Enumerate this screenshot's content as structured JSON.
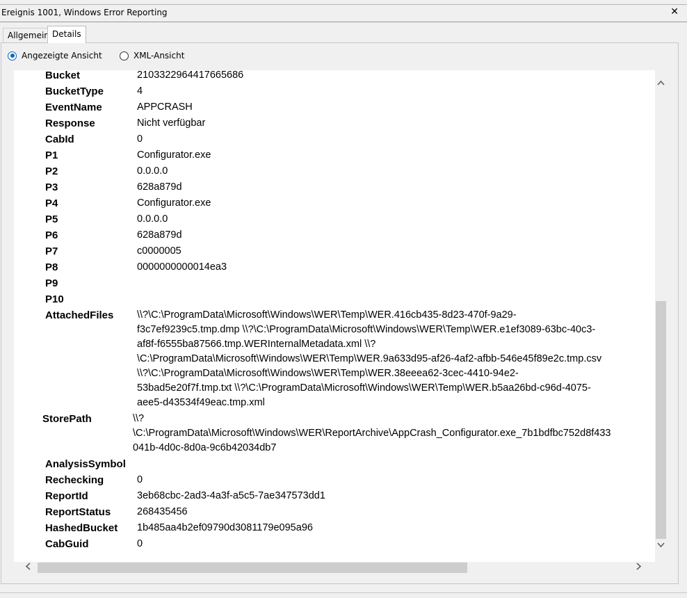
{
  "window": {
    "title": "Ereignis 1001, Windows Error Reporting",
    "close_glyph": "✕"
  },
  "tabs": [
    {
      "label": "Allgemein"
    },
    {
      "label": "Details"
    }
  ],
  "views": {
    "displayed": "Angezeigte Ansicht",
    "xml": "XML-Ansicht"
  },
  "fields": [
    {
      "key": "Bucket",
      "value": "2103322964417665686"
    },
    {
      "key": "BucketType",
      "value": "4"
    },
    {
      "key": "EventName",
      "value": "APPCRASH"
    },
    {
      "key": "Response",
      "value": "Nicht verfügbar"
    },
    {
      "key": "CabId",
      "value": "0"
    },
    {
      "key": "P1",
      "value": "Configurator.exe"
    },
    {
      "key": "P2",
      "value": "0.0.0.0"
    },
    {
      "key": "P3",
      "value": "628a879d"
    },
    {
      "key": "P4",
      "value": "Configurator.exe"
    },
    {
      "key": "P5",
      "value": "0.0.0.0"
    },
    {
      "key": "P6",
      "value": "628a879d"
    },
    {
      "key": "P7",
      "value": "c0000005"
    },
    {
      "key": "P8",
      "value": "0000000000014ea3"
    },
    {
      "key": "P9",
      "value": ""
    },
    {
      "key": "P10",
      "value": ""
    }
  ],
  "attached": {
    "key": "AttachedFiles",
    "lines": [
      "\\\\?\\C:\\ProgramData\\Microsoft\\Windows\\WER\\Temp\\WER.416cb435-8d23-470f-9a29-",
      "f3c7ef9239c5.tmp.dmp \\\\?\\C:\\ProgramData\\Microsoft\\Windows\\WER\\Temp\\WER.e1ef3089-63bc-40c3-",
      "af8f-f6555ba87566.tmp.WERInternalMetadata.xml \\\\?",
      "\\C:\\ProgramData\\Microsoft\\Windows\\WER\\Temp\\WER.9a633d95-af26-4af2-afbb-546e45f89e2c.tmp.csv",
      "\\\\?\\C:\\ProgramData\\Microsoft\\Windows\\WER\\Temp\\WER.38eeea62-3cec-4410-94e2-",
      "53bad5e20f7f.tmp.txt \\\\?\\C:\\ProgramData\\Microsoft\\Windows\\WER\\Temp\\WER.b5aa26bd-c96d-4075-",
      "aee5-d43534f49eac.tmp.xml"
    ]
  },
  "store": {
    "key": "StorePath",
    "lines": [
      "\\\\?",
      "\\C:\\ProgramData\\Microsoft\\Windows\\WER\\ReportArchive\\AppCrash_Configurator.exe_7b1bdfbc752d8f433",
      "041b-4d0c-8d0a-9c6b42034db7"
    ]
  },
  "fields2": [
    {
      "key": "AnalysisSymbol",
      "value": ""
    },
    {
      "key": "Rechecking",
      "value": "0"
    },
    {
      "key": "ReportId",
      "value": "3eb68cbc-2ad3-4a3f-a5c5-7ae347573dd1"
    },
    {
      "key": "ReportStatus",
      "value": "268435456"
    },
    {
      "key": "HashedBucket",
      "value": "1b485aa4b2ef09790d3081179e095a96"
    },
    {
      "key": "CabGuid",
      "value": "0"
    }
  ],
  "icons": {
    "up": "chevron-up-icon",
    "down": "chevron-down-icon",
    "left": "chevron-left-icon",
    "right": "chevron-right-icon"
  },
  "colors": {
    "radio_accent": "#0067c0",
    "scroll_thumb": "#cdcdcd"
  }
}
